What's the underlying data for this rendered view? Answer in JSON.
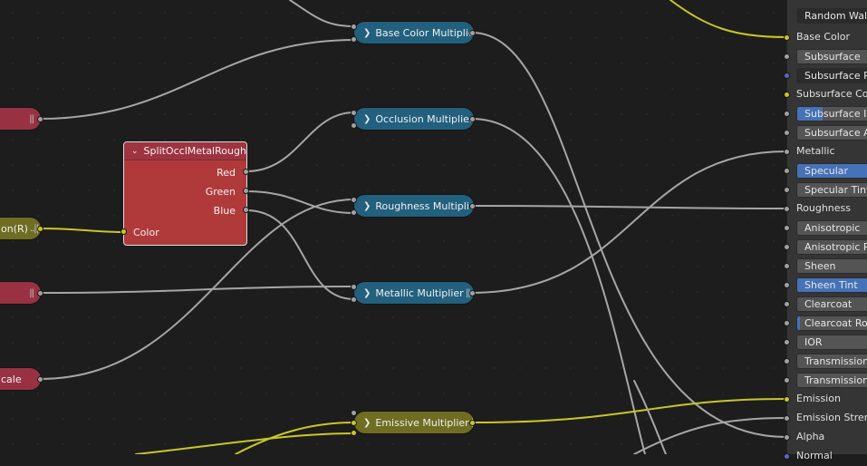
{
  "nodes": {
    "base_color_multiplier": "Base Color Multiplie...",
    "occlusion_multiplier": "Occlusion Multiplier",
    "roughness_multiplier": "Roughness Multiplier",
    "metallic_multiplier": "Metallic Multiplier",
    "emissive_multiplier": "Emissive Multiplier",
    "left_olive_partial": "on(R)",
    "left_bottom_partial": "cale",
    "grip": "||",
    "left_olive_grip": "..||"
  },
  "split_node": {
    "title": "SplitOcclMetalRough",
    "outputs": {
      "red": "Red",
      "green": "Green",
      "blue": "Blue"
    },
    "input": "Color"
  },
  "bsdf_panel": {
    "subsurface_method": "Random Walk",
    "inputs": [
      {
        "label": "Base Color",
        "kind": "label",
        "socket": "yellow"
      },
      {
        "label": "Subsurface",
        "kind": "button",
        "socket": "gray"
      },
      {
        "label": "Subsurface Radius",
        "kind": "dropdown",
        "socket": "purple"
      },
      {
        "label": "Subsurface Color",
        "kind": "label",
        "socket": "yellow"
      },
      {
        "label": "Subsurface IOR",
        "kind": "part",
        "socket": "gray"
      },
      {
        "label": "Subsurface Anisotropy",
        "kind": "button",
        "socket": "gray"
      },
      {
        "label": "Metallic",
        "kind": "label",
        "socket": "gray"
      },
      {
        "label": "Specular",
        "kind": "highlight",
        "socket": "gray"
      },
      {
        "label": "Specular Tint",
        "kind": "button",
        "socket": "gray"
      },
      {
        "label": "Roughness",
        "kind": "label",
        "socket": "gray"
      },
      {
        "label": "Anisotropic",
        "kind": "button",
        "socket": "gray"
      },
      {
        "label": "Anisotropic Rotation",
        "kind": "button",
        "socket": "gray"
      },
      {
        "label": "Sheen",
        "kind": "button",
        "socket": "gray"
      },
      {
        "label": "Sheen Tint",
        "kind": "highlight",
        "socket": "gray"
      },
      {
        "label": "Clearcoat",
        "kind": "button",
        "socket": "gray"
      },
      {
        "label": "Clearcoat Roughness",
        "kind": "sliver",
        "socket": "gray"
      },
      {
        "label": "IOR",
        "kind": "button",
        "socket": "gray"
      },
      {
        "label": "Transmission",
        "kind": "button",
        "socket": "gray"
      },
      {
        "label": "Transmission Roughness",
        "kind": "button",
        "socket": "gray"
      },
      {
        "label": "Emission",
        "kind": "label",
        "socket": "yellow"
      },
      {
        "label": "Emission Strength",
        "kind": "label",
        "socket": "gray"
      },
      {
        "label": "Alpha",
        "kind": "label",
        "socket": "gray"
      },
      {
        "label": "Normal",
        "kind": "label",
        "socket": "purple"
      }
    ]
  },
  "colors": {
    "background": "#1d1d1d",
    "link_gray": "#a6a6a6",
    "link_yellow": "#c7c729",
    "node_blue": "#22607e",
    "node_crimson": "#983243",
    "node_olive": "#6f6d22",
    "frame_red": "#b03a3a",
    "panel": "#353535",
    "highlight": "#4672b8"
  }
}
